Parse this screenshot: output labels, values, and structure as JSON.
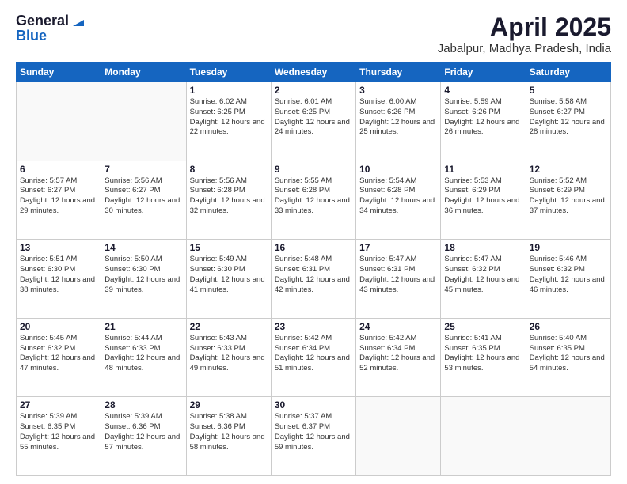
{
  "logo": {
    "general": "General",
    "blue": "Blue"
  },
  "header": {
    "title": "April 2025",
    "subtitle": "Jabalpur, Madhya Pradesh, India"
  },
  "weekdays": [
    "Sunday",
    "Monday",
    "Tuesday",
    "Wednesday",
    "Thursday",
    "Friday",
    "Saturday"
  ],
  "weeks": [
    [
      {
        "day": "",
        "sunrise": "",
        "sunset": "",
        "daylight": ""
      },
      {
        "day": "",
        "sunrise": "",
        "sunset": "",
        "daylight": ""
      },
      {
        "day": "1",
        "sunrise": "Sunrise: 6:02 AM",
        "sunset": "Sunset: 6:25 PM",
        "daylight": "Daylight: 12 hours and 22 minutes."
      },
      {
        "day": "2",
        "sunrise": "Sunrise: 6:01 AM",
        "sunset": "Sunset: 6:25 PM",
        "daylight": "Daylight: 12 hours and 24 minutes."
      },
      {
        "day": "3",
        "sunrise": "Sunrise: 6:00 AM",
        "sunset": "Sunset: 6:26 PM",
        "daylight": "Daylight: 12 hours and 25 minutes."
      },
      {
        "day": "4",
        "sunrise": "Sunrise: 5:59 AM",
        "sunset": "Sunset: 6:26 PM",
        "daylight": "Daylight: 12 hours and 26 minutes."
      },
      {
        "day": "5",
        "sunrise": "Sunrise: 5:58 AM",
        "sunset": "Sunset: 6:27 PM",
        "daylight": "Daylight: 12 hours and 28 minutes."
      }
    ],
    [
      {
        "day": "6",
        "sunrise": "Sunrise: 5:57 AM",
        "sunset": "Sunset: 6:27 PM",
        "daylight": "Daylight: 12 hours and 29 minutes."
      },
      {
        "day": "7",
        "sunrise": "Sunrise: 5:56 AM",
        "sunset": "Sunset: 6:27 PM",
        "daylight": "Daylight: 12 hours and 30 minutes."
      },
      {
        "day": "8",
        "sunrise": "Sunrise: 5:56 AM",
        "sunset": "Sunset: 6:28 PM",
        "daylight": "Daylight: 12 hours and 32 minutes."
      },
      {
        "day": "9",
        "sunrise": "Sunrise: 5:55 AM",
        "sunset": "Sunset: 6:28 PM",
        "daylight": "Daylight: 12 hours and 33 minutes."
      },
      {
        "day": "10",
        "sunrise": "Sunrise: 5:54 AM",
        "sunset": "Sunset: 6:28 PM",
        "daylight": "Daylight: 12 hours and 34 minutes."
      },
      {
        "day": "11",
        "sunrise": "Sunrise: 5:53 AM",
        "sunset": "Sunset: 6:29 PM",
        "daylight": "Daylight: 12 hours and 36 minutes."
      },
      {
        "day": "12",
        "sunrise": "Sunrise: 5:52 AM",
        "sunset": "Sunset: 6:29 PM",
        "daylight": "Daylight: 12 hours and 37 minutes."
      }
    ],
    [
      {
        "day": "13",
        "sunrise": "Sunrise: 5:51 AM",
        "sunset": "Sunset: 6:30 PM",
        "daylight": "Daylight: 12 hours and 38 minutes."
      },
      {
        "day": "14",
        "sunrise": "Sunrise: 5:50 AM",
        "sunset": "Sunset: 6:30 PM",
        "daylight": "Daylight: 12 hours and 39 minutes."
      },
      {
        "day": "15",
        "sunrise": "Sunrise: 5:49 AM",
        "sunset": "Sunset: 6:30 PM",
        "daylight": "Daylight: 12 hours and 41 minutes."
      },
      {
        "day": "16",
        "sunrise": "Sunrise: 5:48 AM",
        "sunset": "Sunset: 6:31 PM",
        "daylight": "Daylight: 12 hours and 42 minutes."
      },
      {
        "day": "17",
        "sunrise": "Sunrise: 5:47 AM",
        "sunset": "Sunset: 6:31 PM",
        "daylight": "Daylight: 12 hours and 43 minutes."
      },
      {
        "day": "18",
        "sunrise": "Sunrise: 5:47 AM",
        "sunset": "Sunset: 6:32 PM",
        "daylight": "Daylight: 12 hours and 45 minutes."
      },
      {
        "day": "19",
        "sunrise": "Sunrise: 5:46 AM",
        "sunset": "Sunset: 6:32 PM",
        "daylight": "Daylight: 12 hours and 46 minutes."
      }
    ],
    [
      {
        "day": "20",
        "sunrise": "Sunrise: 5:45 AM",
        "sunset": "Sunset: 6:32 PM",
        "daylight": "Daylight: 12 hours and 47 minutes."
      },
      {
        "day": "21",
        "sunrise": "Sunrise: 5:44 AM",
        "sunset": "Sunset: 6:33 PM",
        "daylight": "Daylight: 12 hours and 48 minutes."
      },
      {
        "day": "22",
        "sunrise": "Sunrise: 5:43 AM",
        "sunset": "Sunset: 6:33 PM",
        "daylight": "Daylight: 12 hours and 49 minutes."
      },
      {
        "day": "23",
        "sunrise": "Sunrise: 5:42 AM",
        "sunset": "Sunset: 6:34 PM",
        "daylight": "Daylight: 12 hours and 51 minutes."
      },
      {
        "day": "24",
        "sunrise": "Sunrise: 5:42 AM",
        "sunset": "Sunset: 6:34 PM",
        "daylight": "Daylight: 12 hours and 52 minutes."
      },
      {
        "day": "25",
        "sunrise": "Sunrise: 5:41 AM",
        "sunset": "Sunset: 6:35 PM",
        "daylight": "Daylight: 12 hours and 53 minutes."
      },
      {
        "day": "26",
        "sunrise": "Sunrise: 5:40 AM",
        "sunset": "Sunset: 6:35 PM",
        "daylight": "Daylight: 12 hours and 54 minutes."
      }
    ],
    [
      {
        "day": "27",
        "sunrise": "Sunrise: 5:39 AM",
        "sunset": "Sunset: 6:35 PM",
        "daylight": "Daylight: 12 hours and 55 minutes."
      },
      {
        "day": "28",
        "sunrise": "Sunrise: 5:39 AM",
        "sunset": "Sunset: 6:36 PM",
        "daylight": "Daylight: 12 hours and 57 minutes."
      },
      {
        "day": "29",
        "sunrise": "Sunrise: 5:38 AM",
        "sunset": "Sunset: 6:36 PM",
        "daylight": "Daylight: 12 hours and 58 minutes."
      },
      {
        "day": "30",
        "sunrise": "Sunrise: 5:37 AM",
        "sunset": "Sunset: 6:37 PM",
        "daylight": "Daylight: 12 hours and 59 minutes."
      },
      {
        "day": "",
        "sunrise": "",
        "sunset": "",
        "daylight": ""
      },
      {
        "day": "",
        "sunrise": "",
        "sunset": "",
        "daylight": ""
      },
      {
        "day": "",
        "sunrise": "",
        "sunset": "",
        "daylight": ""
      }
    ]
  ]
}
